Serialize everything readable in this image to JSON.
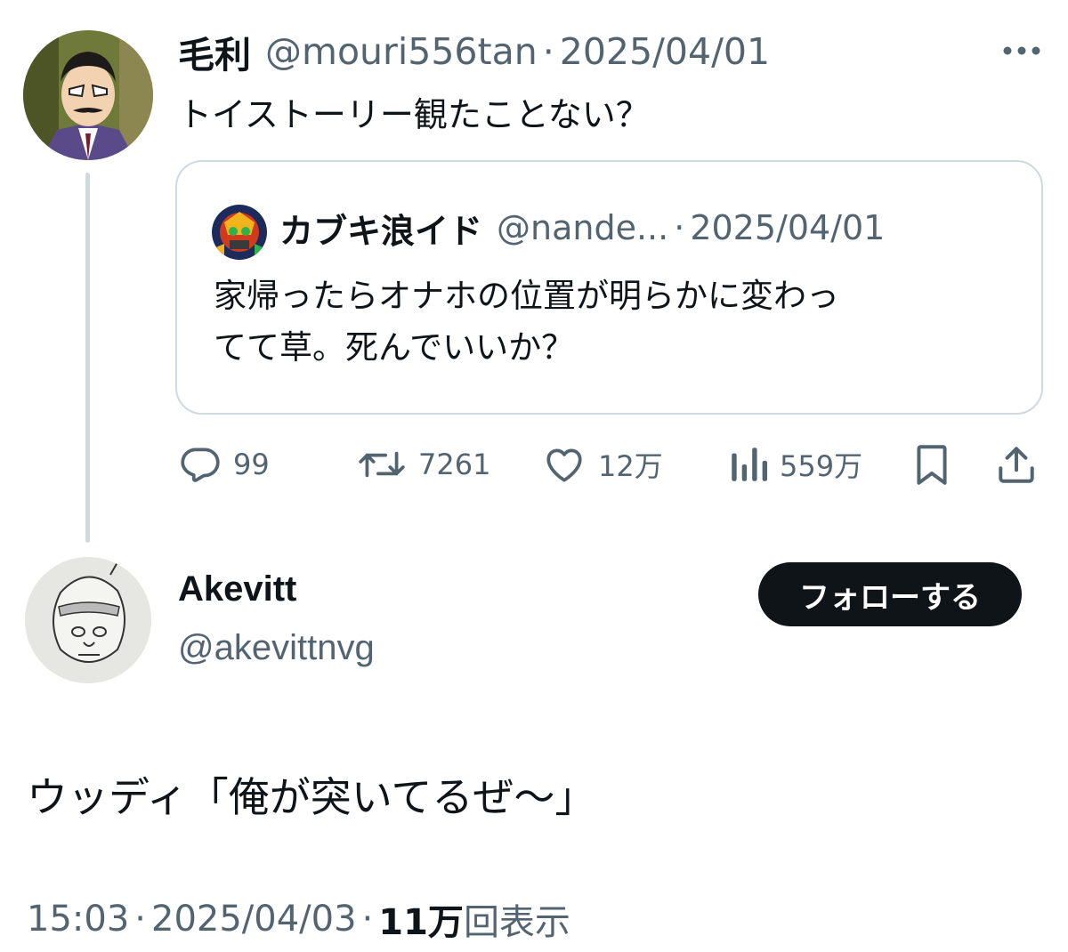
{
  "parent_tweet": {
    "author_name": "毛利",
    "handle": "@mouri556tan",
    "separator": "·",
    "date": "2025/04/01",
    "text": "トイストーリー観たことない？",
    "avatar_icon": "anime-character-avatar",
    "more_icon": "more-dots-icon"
  },
  "quoted_tweet": {
    "author_name": "カブキ浪イド",
    "handle": "@nande...",
    "separator": "·",
    "date": "2025/04/01",
    "text_lines": [
      "家帰ったらオナホの位置が明らかに変わっ",
      "てて草。死んでいいか？"
    ]
  },
  "actions": {
    "replies": "99",
    "reposts": "7261",
    "likes": "12万",
    "views": "559万",
    "reply_icon": "reply-icon",
    "repost_icon": "repost-icon",
    "like_icon": "heart-icon",
    "views_icon": "analytics-icon",
    "bookmark_icon": "bookmark-icon",
    "share_icon": "share-icon"
  },
  "reply_tweet": {
    "author_name": "Akevitt",
    "handle": "@akevittnvg",
    "follow_label": "フォローする",
    "text": "ウッディ「俺が突いてるぜ〜」",
    "time": "15:03",
    "separator": "·",
    "date": "2025/04/03",
    "views_count": "11万",
    "views_label": "回表示"
  },
  "colors": {
    "text_primary": "#0f1419",
    "text_secondary": "#536471",
    "border": "#cfd9de",
    "follow_bg": "#0f1419"
  }
}
